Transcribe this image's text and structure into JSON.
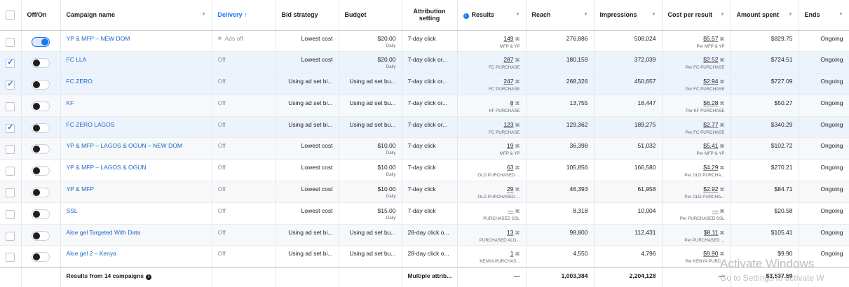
{
  "headers": {
    "offon": "Off/On",
    "name": "Campaign name",
    "delivery": "Delivery ↑",
    "bid": "Bid strategy",
    "budget": "Budget",
    "attribution": "Attribution setting",
    "results": "Results",
    "reach": "Reach",
    "impressions": "Impressions",
    "cpr": "Cost per result",
    "spent": "Amount spent",
    "ends": "Ends"
  },
  "rows": [
    {
      "checked": false,
      "on": true,
      "name": "YP & MFP – NEW DOM",
      "delivery": "Ads off",
      "bid": "Lowest cost",
      "budget": "$20.00",
      "budget_sub": "Daily",
      "attribution": "7-day click",
      "results": "149",
      "results_sub": "MFP & YP",
      "reach": "276,886",
      "impressions": "508,024",
      "cpr": "$5.57",
      "cpr_sub": "Per MFP & YP",
      "spent": "$829.75",
      "ends": "Ongoing"
    },
    {
      "checked": true,
      "on": false,
      "name": "FC LLA",
      "delivery": "Off",
      "bid": "Lowest cost",
      "budget": "$20.00",
      "budget_sub": "Daily",
      "attribution": "7-day click or...",
      "results": "287",
      "results_sub": "FC PURCHASE",
      "reach": "180,159",
      "impressions": "372,039",
      "cpr": "$2.52",
      "cpr_sub": "Per FC PURCHASE",
      "spent": "$724.51",
      "ends": "Ongoing"
    },
    {
      "checked": true,
      "on": false,
      "name": "FC ZERO",
      "delivery": "Off",
      "bid": "Using ad set bi...",
      "budget": "Using ad set bu...",
      "budget_sub": "",
      "attribution": "7-day click or...",
      "results": "247",
      "results_sub": "FC PURCHASE",
      "reach": "268,326",
      "impressions": "450,657",
      "cpr": "$2.94",
      "cpr_sub": "Per FC PURCHASE",
      "spent": "$727.09",
      "ends": "Ongoing"
    },
    {
      "checked": false,
      "on": false,
      "name": "KF",
      "delivery": "Off",
      "bid": "Using ad set bi...",
      "budget": "Using ad set bu...",
      "budget_sub": "",
      "attribution": "7-day click or...",
      "results": "8",
      "results_sub": "KF PURCHASE",
      "reach": "13,755",
      "impressions": "18,447",
      "cpr": "$6.28",
      "cpr_sub": "Per KF PURCHASE",
      "spent": "$50.27",
      "ends": "Ongoing"
    },
    {
      "checked": true,
      "on": false,
      "name": "FC ZERO LAGOS",
      "delivery": "Off",
      "bid": "Using ad set bi...",
      "budget": "Using ad set bu...",
      "budget_sub": "",
      "attribution": "7-day click or...",
      "results": "123",
      "results_sub": "FC PURCHASE",
      "reach": "129,362",
      "impressions": "189,275",
      "cpr": "$2.77",
      "cpr_sub": "Per FC PURCHASE",
      "spent": "$340.29",
      "ends": "Ongoing"
    },
    {
      "checked": false,
      "on": false,
      "name": "YP & MFP – LAGOS & OGUN – NEW DOM",
      "delivery": "Off",
      "bid": "Lowest cost",
      "budget": "$10.00",
      "budget_sub": "Daily",
      "attribution": "7-day click",
      "results": "19",
      "results_sub": "MFP & YP",
      "reach": "36,398",
      "impressions": "51,032",
      "cpr": "$5.41",
      "cpr_sub": "Per MFP & YP",
      "spent": "$102.72",
      "ends": "Ongoing"
    },
    {
      "checked": false,
      "on": false,
      "name": "YP & MFP – LAGOS & OGUN",
      "delivery": "Off",
      "bid": "Lowest cost",
      "budget": "$10.00",
      "budget_sub": "Daily",
      "attribution": "7-day click",
      "results": "63",
      "results_sub": "OLD PURCHASED ...",
      "reach": "105,856",
      "impressions": "166,580",
      "cpr": "$4.29",
      "cpr_sub": "Per OLD PURCHA...",
      "spent": "$270.21",
      "ends": "Ongoing"
    },
    {
      "checked": false,
      "on": false,
      "name": "YP & MFP",
      "delivery": "Off",
      "bid": "Lowest cost",
      "budget": "$10.00",
      "budget_sub": "Daily",
      "attribution": "7-day click",
      "results": "29",
      "results_sub": "OLD PURCHASED ...",
      "reach": "46,393",
      "impressions": "61,958",
      "cpr": "$2.92",
      "cpr_sub": "Per OLD PURCHA...",
      "spent": "$84.71",
      "ends": "Ongoing"
    },
    {
      "checked": false,
      "on": false,
      "name": "SSL",
      "delivery": "Off",
      "bid": "Lowest cost",
      "budget": "$15.00",
      "budget_sub": "Daily",
      "attribution": "7-day click",
      "results": "—",
      "results_sub": "PURCHASED SSL",
      "reach": "8,318",
      "impressions": "10,004",
      "cpr": "—",
      "cpr_sub": "Per PURCHASED SSL",
      "spent": "$20.58",
      "ends": "Ongoing"
    },
    {
      "checked": false,
      "on": false,
      "name": "Aloe gel Targeted With Data",
      "delivery": "Off",
      "bid": "Using ad set bi...",
      "budget": "Using ad set bu...",
      "budget_sub": "",
      "attribution": "28-day click o...",
      "results": "13",
      "results_sub": "PURCHASED ALO...",
      "reach": "98,800",
      "impressions": "112,431",
      "cpr": "$8.11",
      "cpr_sub": "Per PURCHASED ...",
      "spent": "$105.41",
      "ends": "Ongoing"
    },
    {
      "checked": false,
      "on": false,
      "name": "Aloe gel 2 – Kenya",
      "delivery": "Off",
      "bid": "Using ad set bi...",
      "budget": "Using ad set bu...",
      "budget_sub": "",
      "attribution": "28-day click o...",
      "results": "1",
      "results_sub": "KENYA PURCHAS...",
      "reach": "4,550",
      "impressions": "4,796",
      "cpr": "$9.90",
      "cpr_sub": "Per KENYA PURC...",
      "spent": "$9.90",
      "ends": "Ongoing"
    }
  ],
  "footer": {
    "label": "Results from 14 campaigns",
    "attribution": "Multiple attrib...",
    "results": "—",
    "reach": "1,003,384",
    "impressions": "2,204,128",
    "cpr": "—",
    "spent": "$3,537.59"
  },
  "watermark": {
    "line1": "Activate Windows",
    "line2": "Go to Settings to activate W"
  }
}
